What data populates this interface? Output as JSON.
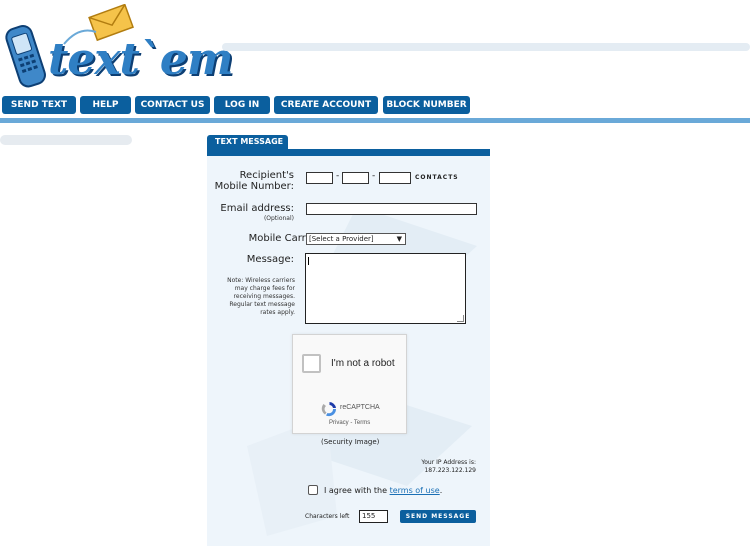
{
  "brand": {
    "logo_text": "text`em"
  },
  "nav": {
    "items": [
      {
        "label": "SEND TEXT"
      },
      {
        "label": "HELP"
      },
      {
        "label": "CONTACT US"
      },
      {
        "label": "LOG IN"
      },
      {
        "label": "CREATE ACCOUNT"
      },
      {
        "label": "BLOCK NUMBER"
      }
    ]
  },
  "form": {
    "tab_label": "TEXT MESSAGE",
    "recipient_label_line1": "Recipient's",
    "recipient_label_line2": "Mobile Number:",
    "phone_separator": "-",
    "contacts_label": "CONTACTS",
    "email_label": "Email address:",
    "email_optional": "(Optional)",
    "carrier_label": "Mobile Carrier:",
    "carrier_selected": "[Select a Provider]",
    "message_label": "Message:",
    "note": "Note: Wireless carriers may charge fees for receiving messages. Regular text message rates apply.",
    "captcha_text": "I'm not a robot",
    "captcha_brand": "reCAPTCHA",
    "captcha_links": "Privacy - Terms",
    "security_image_label": "(Security Image)",
    "ip_label": "Your IP Address is:",
    "ip_value": "187.223.122.129",
    "agree_prefix": "I agree with the ",
    "agree_link": "terms of use",
    "agree_suffix": ".",
    "chars_left_label": "Characters left",
    "chars_left_value": "155",
    "send_label": "SEND MESSAGE"
  },
  "colors": {
    "nav_blue": "#0b5f9e",
    "light_blue_line": "#6aa9d8",
    "panel_bg": "#eef5fb",
    "link": "#1a6fb5"
  }
}
